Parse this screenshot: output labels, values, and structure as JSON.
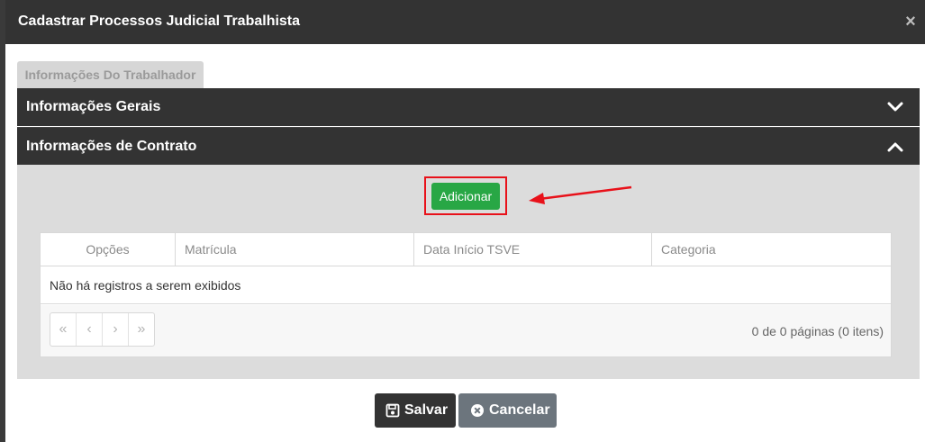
{
  "modal": {
    "title": "Cadastrar Processos Judicial Trabalhista",
    "close_glyph": "×"
  },
  "tabs": [
    {
      "label": "Informações Do Trabalhador"
    }
  ],
  "accordion": [
    {
      "label": "Informações Gerais",
      "state": "collapsed",
      "icon": "chevron-down-icon"
    },
    {
      "label": "Informações de Contrato",
      "state": "expanded",
      "icon": "chevron-up-icon"
    }
  ],
  "contract_panel": {
    "add_label": "Adicionar",
    "table": {
      "columns": [
        "Opções",
        "Matrícula",
        "Data Início TSVE",
        "Categoria"
      ],
      "empty_message": "Não há registros a serem exibidos"
    },
    "pager": {
      "buttons": [
        "«",
        "‹",
        "›",
        "»"
      ],
      "info": "0 de 0 páginas (0 itens)"
    }
  },
  "footer": {
    "save_label": "Salvar",
    "cancel_label": "Cancelar"
  },
  "colors": {
    "header_bg": "#333333",
    "add_button": "#28a745",
    "highlight": "#e8111a",
    "cancel_button": "#6c757d"
  }
}
